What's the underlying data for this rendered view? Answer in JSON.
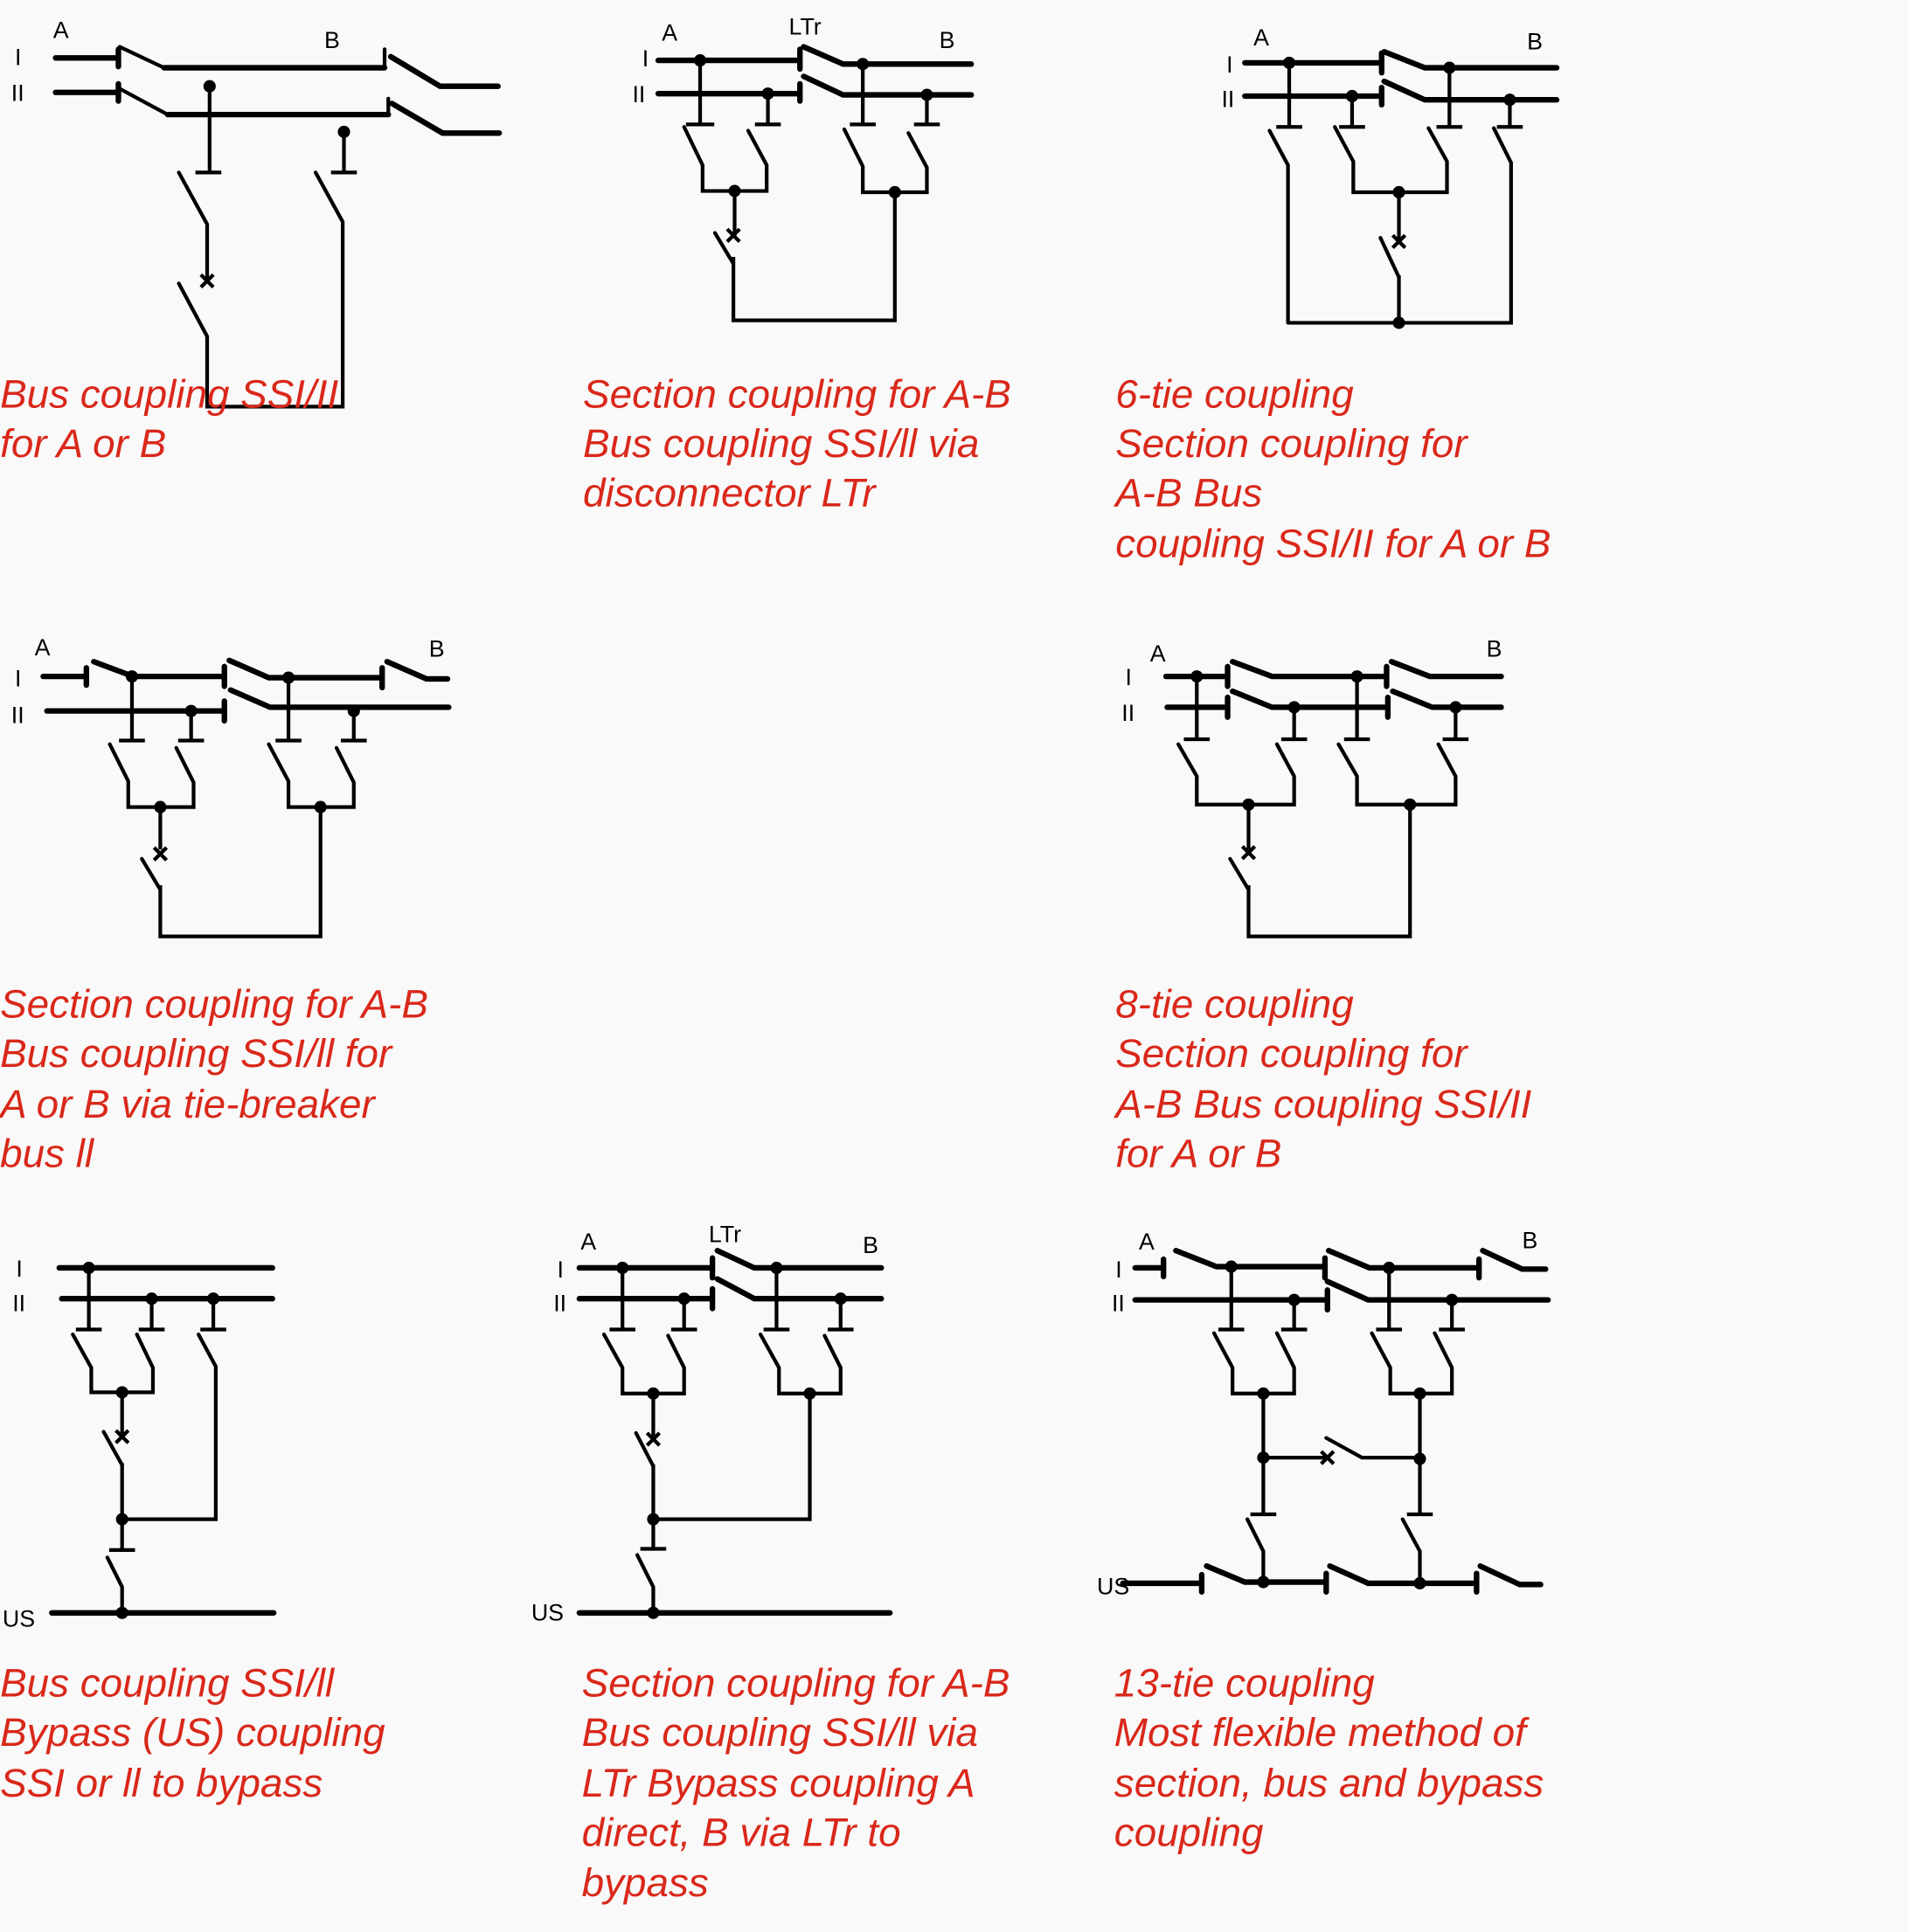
{
  "colors": {
    "caption": "#d9281a",
    "line": "#000000",
    "background": "#f9f9f9"
  },
  "labels": {
    "bus_I": "I",
    "bus_II": "II",
    "section_A": "A",
    "section_B": "B",
    "disconnector": "LTr",
    "bypass": "US"
  },
  "diagrams": [
    {
      "id": "bus-coupling-ab",
      "caption": [
        "Bus coupling SSI/II",
        "for A or B"
      ]
    },
    {
      "id": "section-coupling-ltr",
      "caption": [
        "Section coupling for A-B",
        "Bus coupling SSI/ll via",
        "disconnector LTr"
      ]
    },
    {
      "id": "six-tie-coupling",
      "caption": [
        "6-tie coupling",
        "Section coupling for",
        "A-B Bus",
        "coupling SSI/II for A or B"
      ]
    },
    {
      "id": "section-coupling-tie-breaker",
      "caption": [
        "Section coupling for A-B",
        "Bus coupling SSI/ll for",
        "A or B via tie-breaker",
        "bus ll"
      ]
    },
    {
      "id": "eight-tie-coupling",
      "caption": [
        "8-tie coupling",
        "Section coupling for",
        "A-B Bus coupling SSI/II",
        "for A or B"
      ]
    },
    {
      "id": "bypass-coupling",
      "caption": [
        "Bus coupling SSI/ll",
        "Bypass (US) coupling",
        "SSI or ll to bypass"
      ]
    },
    {
      "id": "section-bypass-ltr",
      "caption": [
        "Section coupling for A-B",
        "Bus coupling SSI/ll via",
        "LTr Bypass coupling A",
        "direct, B via LTr to",
        "bypass"
      ]
    },
    {
      "id": "thirteen-tie-coupling",
      "caption": [
        "13-tie coupling",
        "Most flexible method of",
        "section, bus and bypass",
        "coupling"
      ]
    }
  ]
}
